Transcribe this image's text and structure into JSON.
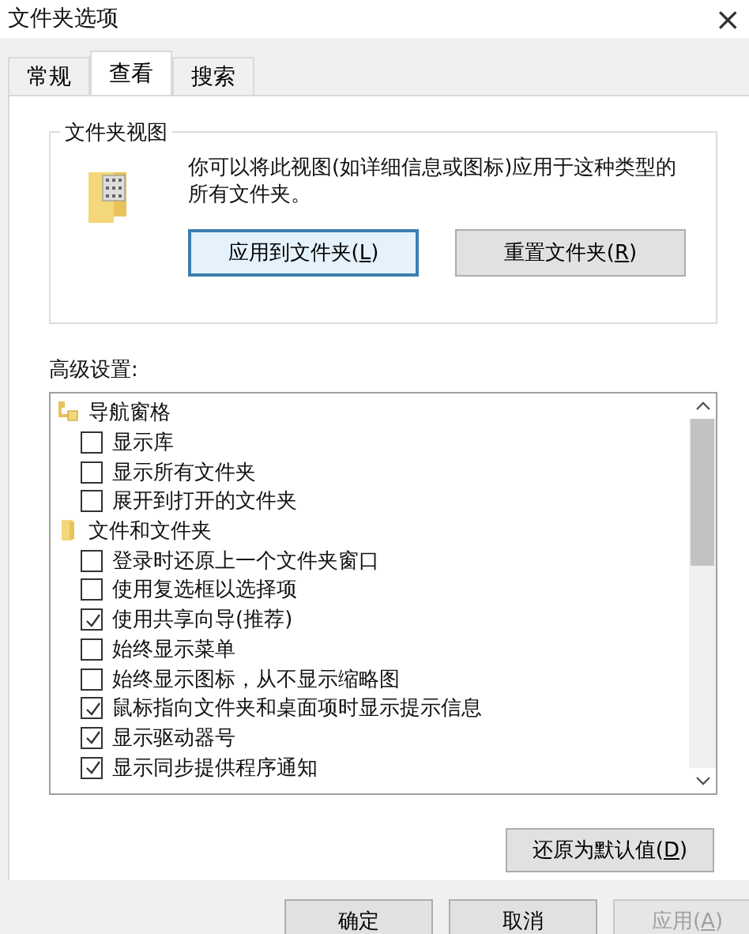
{
  "window": {
    "title": "文件夹选项",
    "close": "×"
  },
  "tabs": [
    {
      "label": "常规",
      "selected": false
    },
    {
      "label": "查看",
      "selected": true
    },
    {
      "label": "搜索",
      "selected": false
    }
  ],
  "folder_views": {
    "title": "文件夹视图",
    "description": "你可以将此视图(如详细信息或图标)应用于这种类型的所有文件夹。",
    "buttons": [
      {
        "before": "应用到文件夹(",
        "key": "L",
        "after": ")",
        "focused": true
      },
      {
        "before": "重置文件夹(",
        "key": "R",
        "after": ")",
        "focused": false
      }
    ]
  },
  "advanced": {
    "label": "高级设置:",
    "tree": [
      {
        "kind": "nav",
        "label": "导航窗格",
        "children": [
          {
            "label": "显示库",
            "checked": false
          },
          {
            "label": "显示所有文件夹",
            "checked": false
          },
          {
            "label": "展开到打开的文件夹",
            "checked": false
          }
        ]
      },
      {
        "kind": "folder",
        "label": "文件和文件夹",
        "children": [
          {
            "label": "登录时还原上一个文件夹窗口",
            "checked": false
          },
          {
            "label": "使用复选框以选择项",
            "checked": false
          },
          {
            "label": "使用共享向导(推荐)",
            "checked": true
          },
          {
            "label": "始终显示菜单",
            "checked": false
          },
          {
            "label": "始终显示图标，从不显示缩略图",
            "checked": false
          },
          {
            "label": "鼠标指向文件夹和桌面项时显示提示信息",
            "checked": true
          },
          {
            "label": "显示驱动器号",
            "checked": true
          },
          {
            "label": "显示同步提供程序通知",
            "checked": true
          }
        ]
      }
    ],
    "restore": {
      "before": "还原为默认值(",
      "key": "D",
      "after": ")"
    }
  },
  "footer": [
    {
      "label": "确定",
      "disabled": false
    },
    {
      "label": "取消",
      "disabled": false
    },
    {
      "before": "应用(",
      "key": "A",
      "after": ")",
      "disabled": true
    }
  ]
}
